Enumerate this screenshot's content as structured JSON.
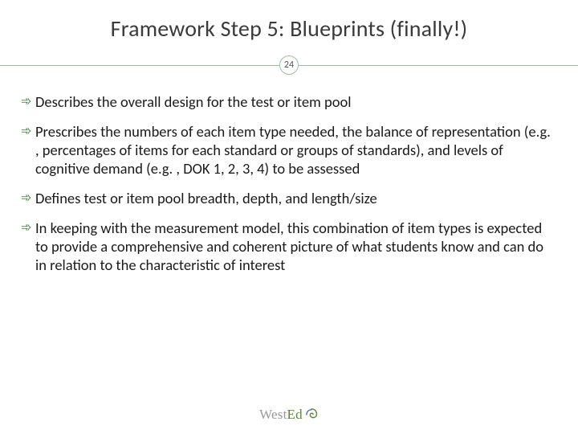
{
  "title": "Framework Step 5: Blueprints (finally!)",
  "page_number": "24",
  "bullets": [
    "Describes the overall design for the test or item pool",
    "Prescribes the numbers of each item type needed, the balance of representation (e.g. , percentages of items for each standard or groups of standards), and levels of cognitive demand (e.g. , DOK 1, 2, 3, 4) to be assessed",
    "Defines test or item pool breadth, depth, and length/size",
    "In keeping with the measurement model, this combination of item types is expected to provide a comprehensive and coherent picture of what students know and can do in relation to the characteristic of interest"
  ],
  "logo": {
    "part1": "West",
    "part2": "Ed"
  },
  "colors": {
    "accent_green": "#5a8a32",
    "rule_green": "#9fbf9f",
    "bullet_green": "#2e6b2e",
    "title_gray": "#3a3a3a"
  }
}
